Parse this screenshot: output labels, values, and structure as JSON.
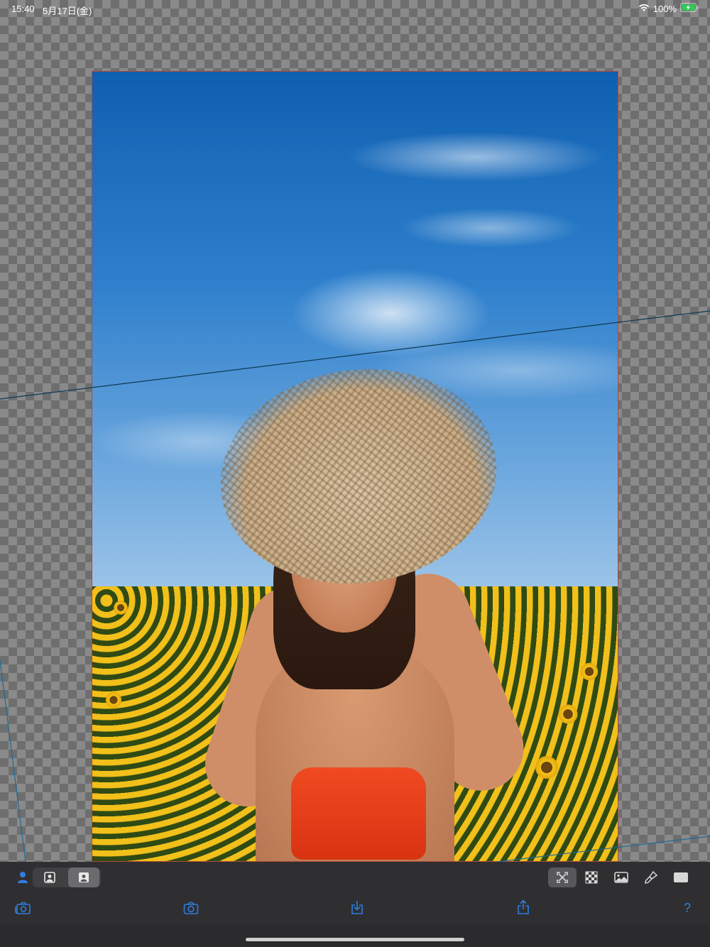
{
  "status_bar": {
    "time": "15:40",
    "date": "5月17日(金)",
    "battery_percent": "100%",
    "icons": [
      "wifi-icon",
      "battery-charging-icon"
    ]
  },
  "editor": {
    "layer_mode_icons": [
      "person-icon",
      "portrait-layer-icon",
      "portrait-layer-filled-icon"
    ],
    "selected_layer_mode": "portrait-layer-filled-icon",
    "view_mode_icons": [
      "fit-screen-icon",
      "transparency-grid-icon",
      "image-background-icon",
      "brush-icon",
      "solid-rectangle-icon"
    ],
    "selected_view_mode": "fit-screen-icon"
  },
  "bottom_toolbar": {
    "icons": [
      "camera-switch-icon",
      "camera-icon",
      "save-download-icon",
      "share-icon"
    ],
    "help_label": "?"
  },
  "colors": {
    "accent": "#2f7de1",
    "toolbar": "#2f2f31",
    "selection_border": "#b04a3a"
  }
}
